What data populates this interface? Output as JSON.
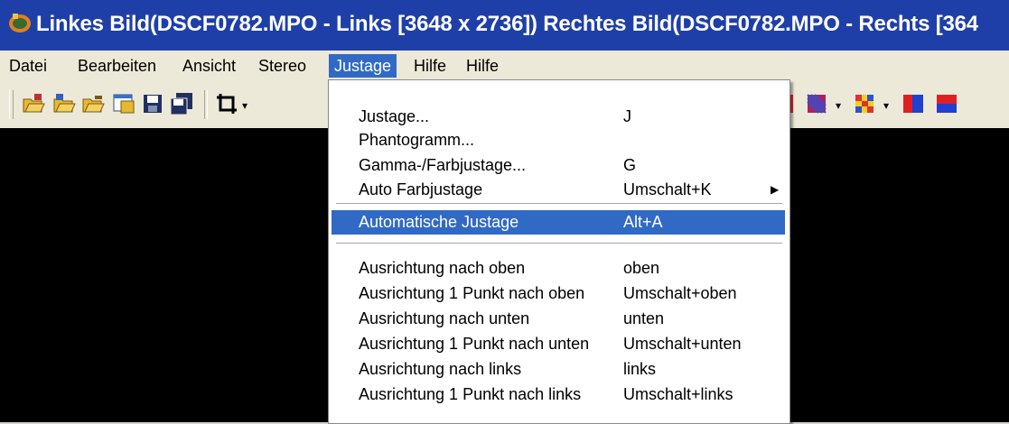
{
  "window": {
    "title": "Linkes Bild(DSCF0782.MPO - Links [3648 x 2736]) Rechtes Bild(DSCF0782.MPO - Rechts [364"
  },
  "menubar": {
    "items": [
      {
        "label": "Datei"
      },
      {
        "label": "Bearbeiten"
      },
      {
        "label": "Ansicht"
      },
      {
        "label": "Stereo"
      },
      {
        "label": "Justage",
        "active": true
      },
      {
        "label": "Hilfe"
      },
      {
        "label": "Hilfe"
      }
    ]
  },
  "toolbar": {
    "icons": [
      "open-left-icon",
      "open-right-icon",
      "open-pair-icon",
      "view-icon",
      "save-icon",
      "save-all-icon",
      "crop-tool-icon",
      "anaglyph-pattern-icon",
      "interlace-pattern-icon",
      "red-cyan-icon",
      "red-blue-icon"
    ]
  },
  "justage_menu": {
    "items": [
      {
        "label": "Justage...",
        "shortcut": "J"
      },
      {
        "label": "Phantogramm...",
        "shortcut": ""
      },
      {
        "label": "Gamma-/Farbjustage...",
        "shortcut": "G"
      },
      {
        "label": "Auto Farbjustage",
        "shortcut": "Umschalt+K",
        "submenu": true
      },
      {
        "label": "Automatische Justage",
        "shortcut": "Alt+A",
        "highlighted": true
      },
      {
        "label": "Ausrichtung nach oben",
        "shortcut": "oben"
      },
      {
        "label": "Ausrichtung 1 Punkt nach oben",
        "shortcut": "Umschalt+oben"
      },
      {
        "label": "Ausrichtung nach unten",
        "shortcut": "unten"
      },
      {
        "label": "Ausrichtung 1 Punkt nach unten",
        "shortcut": "Umschalt+unten"
      },
      {
        "label": "Ausrichtung nach links",
        "shortcut": "links"
      },
      {
        "label": "Ausrichtung 1 Punkt nach links",
        "shortcut": "Umschalt+links"
      }
    ]
  },
  "colors": {
    "titlebar": "#1f3fa8",
    "highlight": "#316ac5",
    "canvas": "#000000"
  }
}
